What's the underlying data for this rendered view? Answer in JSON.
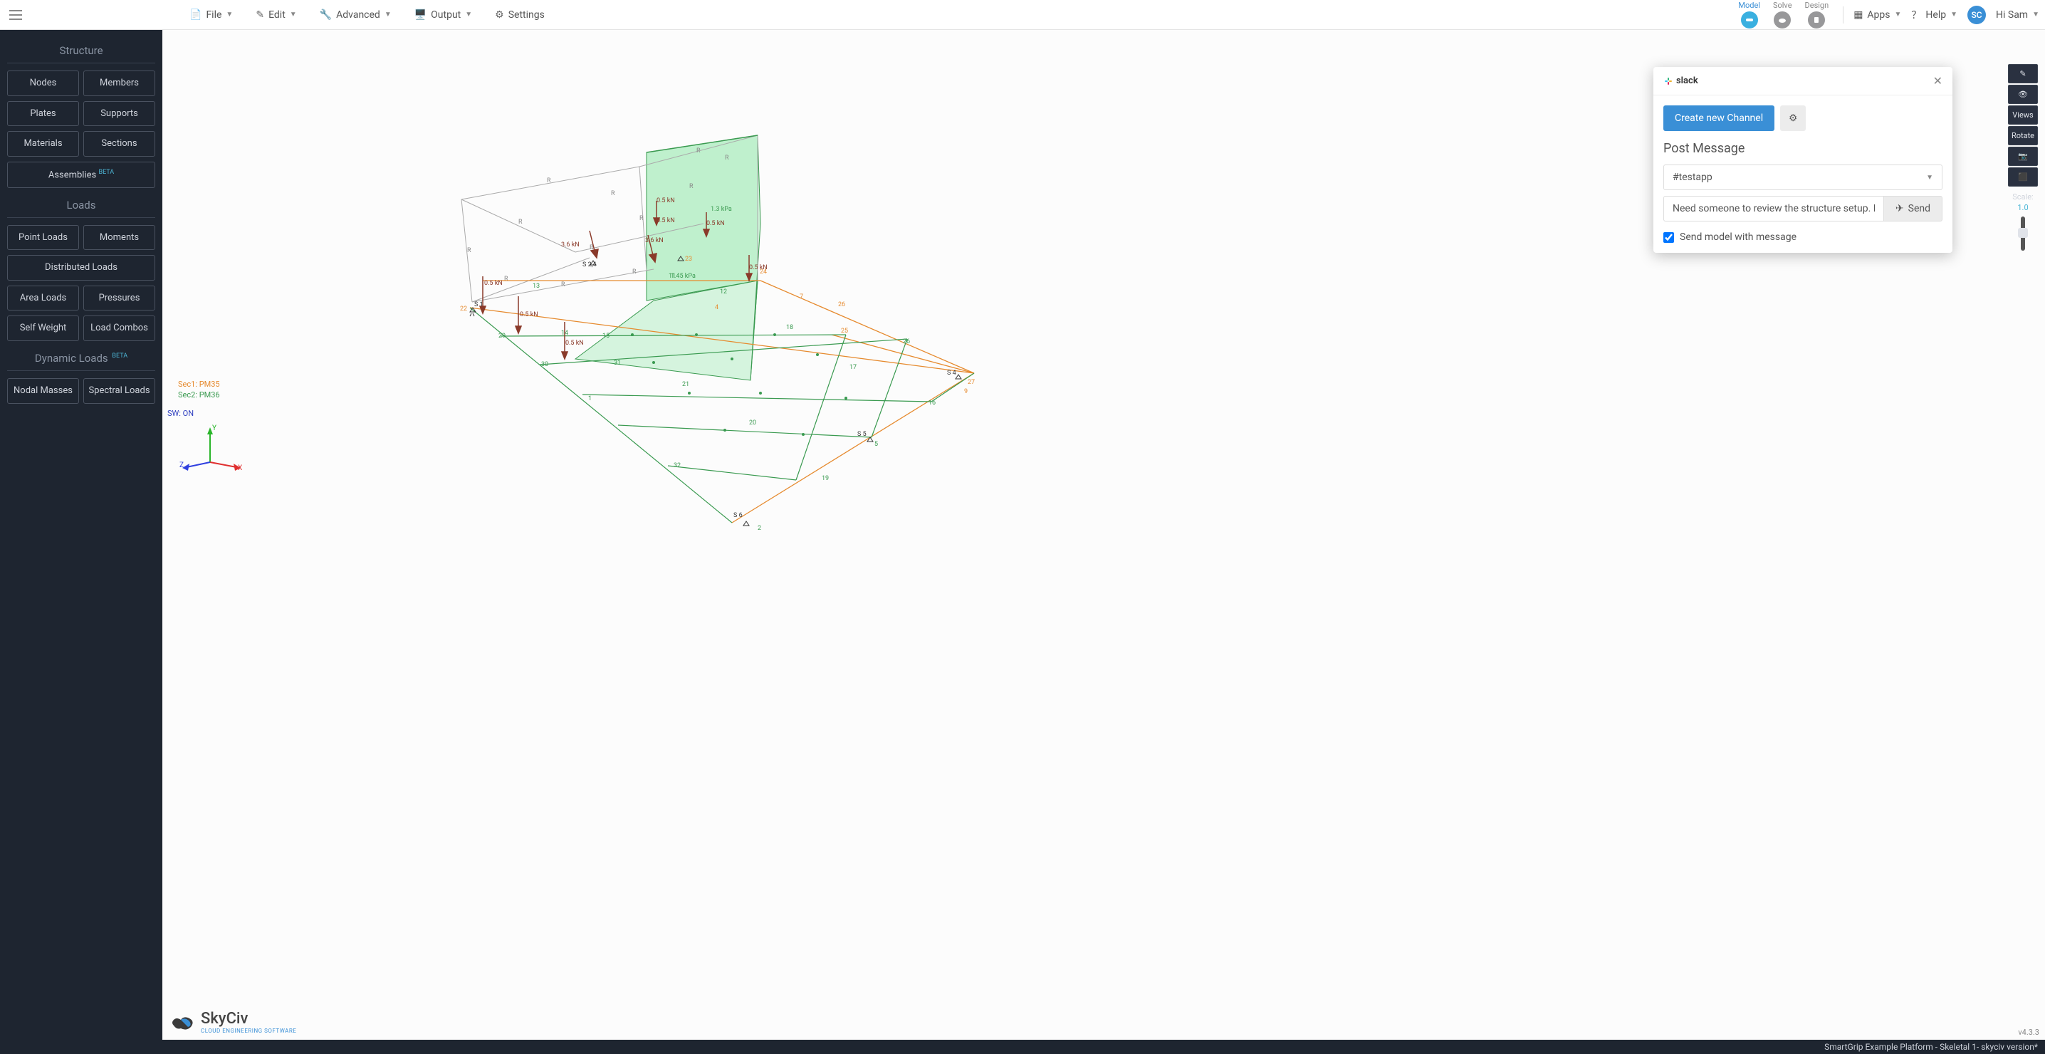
{
  "topmenu": {
    "file": "File",
    "edit": "Edit",
    "advanced": "Advanced",
    "output": "Output",
    "settings": "Settings"
  },
  "tabs": {
    "model": "Model",
    "solve": "Solve",
    "design": "Design"
  },
  "top_right": {
    "apps": "Apps",
    "help": "Help",
    "user_initials": "SC",
    "greeting": "Hi Sam"
  },
  "sidebar": {
    "structure_heading": "Structure",
    "structure": {
      "nodes": "Nodes",
      "members": "Members",
      "plates": "Plates",
      "supports": "Supports",
      "materials": "Materials",
      "sections": "Sections",
      "assemblies": "Assemblies",
      "beta": "BETA"
    },
    "loads_heading": "Loads",
    "loads": {
      "point": "Point Loads",
      "moments": "Moments",
      "distributed": "Distributed Loads",
      "area": "Area Loads",
      "pressures": "Pressures",
      "selfweight": "Self Weight",
      "combos": "Load Combos"
    },
    "dynamic_heading": "Dynamic Loads",
    "dynamic_beta": "BETA",
    "dynamic": {
      "nodal": "Nodal Masses",
      "spectral": "Spectral Loads"
    }
  },
  "right_tools": {
    "views": "Views",
    "rotate": "Rotate",
    "scale_label": "Scale:",
    "scale_value": "1.0"
  },
  "slack": {
    "brand": "slack",
    "create": "Create new Channel",
    "heading": "Post Message",
    "channel": "#testapp",
    "message": "Need someone to review the structure setup. I used rigid",
    "send": "Send",
    "checkbox": "Send model with message"
  },
  "canvas": {
    "sec1": "Sec1: PM35",
    "sec2": "Sec2: PM36",
    "sw": "SW: ON",
    "axis": {
      "x": "X",
      "y": "Y",
      "z": "Z"
    },
    "labels": {
      "kpa1": "1.3 kPa",
      "kpa2": "1.45 kPa",
      "kn36a": "3.6 kN",
      "kn36b": "3.6 kN",
      "kn05a": "0.5 kN",
      "kn05b": "0.5 kN",
      "kn05c": "0.5 kN",
      "kn05d": "0.5 kN",
      "kn05e": "0.5 kN",
      "kn05f": "0.5 kN",
      "kn05g": "0.5 kN",
      "s1": "S 1",
      "s24": "S 2,4",
      "s4": "S 4",
      "s5": "S 5",
      "s6": "S 6"
    },
    "brand": "SkyCiv",
    "brand_sub": "CLOUD ENGINEERING SOFTWARE",
    "version": "v4.3.3"
  },
  "footer": {
    "text": "SmartGrip Example Platform - Skeletal 1- skyciv version*"
  }
}
